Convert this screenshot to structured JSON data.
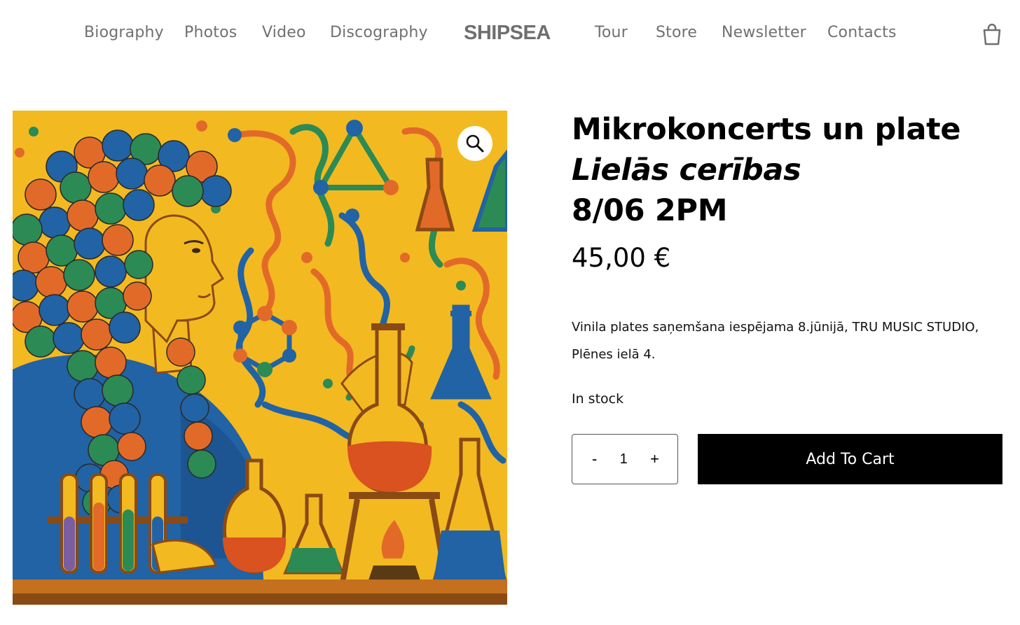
{
  "header": {
    "nav_left": [
      "Biography",
      "Photos",
      "Video",
      "Discography"
    ],
    "logo": "SHIPSEA",
    "nav_right": [
      "Tour",
      "Store",
      "Newsletter",
      "Contacts"
    ],
    "cart_icon": "shopping-bag-icon"
  },
  "product": {
    "title_line1": "Mikrokoncerts un plate",
    "title_line2": "Lielās cerības",
    "title_line3": "8/06 2PM",
    "price": "45,00 €",
    "description": "Vinila plates saņemšana iespējama 8.jūnijā, TRU MUSIC STUDIO, Plēnes ielā 4.",
    "stock": "In stock",
    "quantity": "1",
    "minus_label": "-",
    "plus_label": "+",
    "add_to_cart_label": "Add To Cart",
    "zoom_icon": "magnifier-icon"
  },
  "colors": {
    "background": "#ffffff",
    "nav_text": "#707070",
    "button_bg": "#000000",
    "button_text": "#ffffff",
    "artwork_yellow": "#f3b921",
    "artwork_blue": "#2163a4",
    "artwork_orange": "#d9521f",
    "artwork_green": "#2c8a55"
  }
}
